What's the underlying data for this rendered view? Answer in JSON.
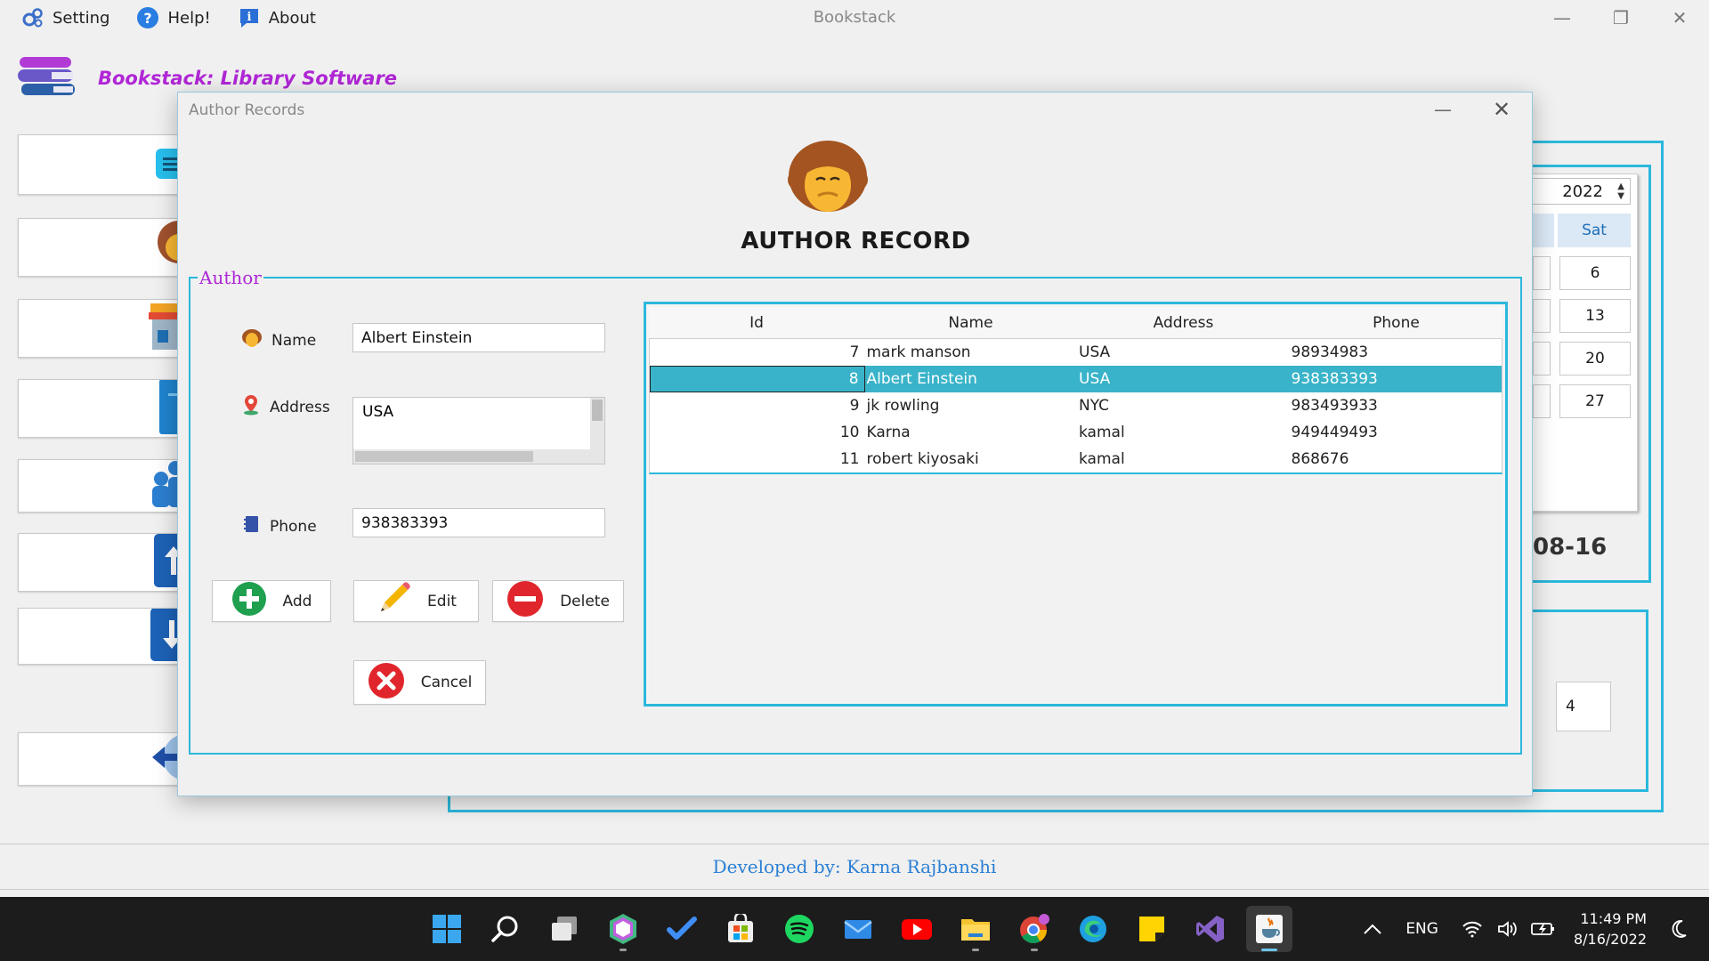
{
  "app": {
    "title": "Bookstack",
    "menu": [
      {
        "label": "Setting",
        "icon": "gears-icon"
      },
      {
        "label": "Help!",
        "icon": "help-icon"
      },
      {
        "label": "About",
        "icon": "info-icon"
      }
    ],
    "brand": "Bookstack: Library Software",
    "footer": "Developed by: Karna Rajbanshi"
  },
  "background": {
    "year": "2022",
    "weekday_header": "Sat",
    "days": [
      "6",
      "13",
      "20",
      "27"
    ],
    "date_partial": "08-16",
    "count_value": "4"
  },
  "dialog": {
    "window_title": "Author Records",
    "heading": "AUTHOR RECORD",
    "group_label": "Author",
    "form": {
      "name_label": "Name",
      "name_value": "Albert Einstein",
      "address_label": "Address",
      "address_value": "USA",
      "phone_label": "Phone",
      "phone_value": "938383393"
    },
    "buttons": {
      "add": "Add",
      "edit": "Edit",
      "delete": "Delete",
      "cancel": "Cancel"
    },
    "table": {
      "columns": [
        "Id",
        "Name",
        "Address",
        "Phone"
      ],
      "rows": [
        {
          "id": "7",
          "name": "mark manson",
          "address": "USA",
          "phone": "98934983"
        },
        {
          "id": "8",
          "name": "Albert Einstein",
          "address": "USA",
          "phone": "938383393"
        },
        {
          "id": "9",
          "name": "jk rowling",
          "address": "NYC",
          "phone": "983493933"
        },
        {
          "id": "10",
          "name": "Karna",
          "address": "kamal",
          "phone": "949449493"
        },
        {
          "id": "11",
          "name": "robert kiyosaki",
          "address": "kamal",
          "phone": "868676"
        }
      ],
      "selected_id": "8"
    }
  },
  "taskbar": {
    "apps": [
      "windows-start-icon",
      "search-icon",
      "task-view-icon",
      "jetbrains-icon",
      "todo-icon",
      "store-icon",
      "spotify-icon",
      "mail-icon",
      "youtube-icon",
      "file-explorer-icon",
      "chrome-icon",
      "edge-icon",
      "sticky-notes-icon",
      "visual-studio-icon",
      "java-icon"
    ],
    "language": "ENG",
    "time": "11:49 PM",
    "date": "8/16/2022"
  },
  "colors": {
    "accent": "#2bb8dc",
    "brand_purple": "#b026d6",
    "selected_row": "#39b3c9",
    "footer_blue": "#2b7fd4"
  }
}
